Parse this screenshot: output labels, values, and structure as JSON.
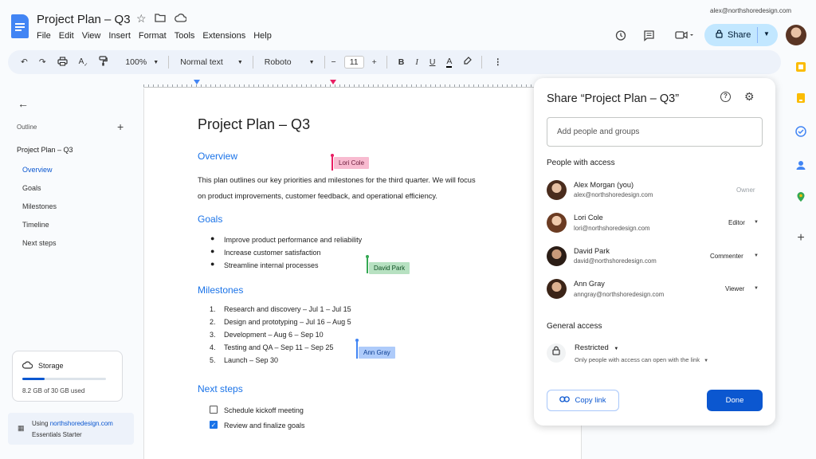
{
  "header": {
    "doc_title": "Project Plan – Q3",
    "account_email": "alex@northshoredesign.com",
    "menu": [
      "File",
      "Edit",
      "View",
      "Insert",
      "Format",
      "Tools",
      "Extensions",
      "Help"
    ],
    "share_label": "Share",
    "icons": [
      "star-icon",
      "folder-icon",
      "cloud-icon",
      "history-icon",
      "comment-icon",
      "video-icon",
      "lock-icon",
      "avatar"
    ]
  },
  "toolbar": {
    "zoom": "100%",
    "style": "Normal text",
    "font": "Roboto",
    "font_size": "11",
    "minus": "−",
    "plus": "+",
    "bold": "B",
    "italic": "I",
    "underline": "U",
    "textcolor": "A"
  },
  "outline": {
    "label": "Outline",
    "doc_title": "Project Plan – Q3",
    "items": [
      "Overview",
      "Goals",
      "Milestones",
      "Timeline",
      "Next steps"
    ],
    "active_item": "Overview",
    "storage_title": "Storage",
    "storage_used": "8.2 GB of 30 GB used",
    "storage_fraction": 0.27,
    "workspace_line1_prefix": "Using ",
    "workspace_domain": "northshoredesign.com",
    "workspace_line2": "Essentials Starter"
  },
  "document": {
    "title": "Project Plan – Q3",
    "overview_heading": "Overview",
    "overview_text": "This plan outlines our key priorities and milestones for the third quarter. We will focus on product improvements, customer feedback, and operational efficiency.",
    "goals_heading": "Goals",
    "goals": [
      "Improve product performance and reliability",
      "Increase customer satisfaction",
      "Streamline internal processes"
    ],
    "milestones_heading": "Milestones",
    "milestones": [
      "Research and discovery – Jul 1 – Jul 15",
      "Design and prototyping – Jul 16 – Aug 5",
      "Development – Aug 6 – Sep 10",
      "Testing and QA – Sep 11 – Sep 25",
      "Launch – Sep 30"
    ],
    "milestone_numbers": [
      "1.",
      "2.",
      "3.",
      "4.",
      "5."
    ],
    "next_heading": "Next steps",
    "tasks": [
      {
        "label": "Schedule kickoff meeting",
        "checked": false
      },
      {
        "label": "Review and finalize goals",
        "checked": true
      }
    ],
    "cursors": [
      {
        "name": "Lori Cole",
        "color": "#f8bbd0",
        "bar": "#e91e63"
      },
      {
        "name": "David Park",
        "color": "#b7e1c1",
        "bar": "#34a853"
      },
      {
        "name": "Ann Gray",
        "color": "#aecbfa",
        "bar": "#4285f4"
      }
    ]
  },
  "share_dialog": {
    "title": "Share “Project Plan – Q3”",
    "add_placeholder": "Add people and groups",
    "people_heading": "People with access",
    "people": [
      {
        "name": "Alex Morgan (you)",
        "email": "alex@northshoredesign.com",
        "role": "Owner"
      },
      {
        "name": "Lori Cole",
        "email": "lori@northshoredesign.com",
        "role": "Editor"
      },
      {
        "name": "David Park",
        "email": "david@northshoredesign.com",
        "role": "Commenter"
      },
      {
        "name": "Ann Gray",
        "email": "anngray@northshoredesign.com",
        "role": "Viewer"
      }
    ],
    "general_heading": "General access",
    "access_level": "Restricted",
    "access_desc": "Only people with access can open with the link",
    "copy_link": "Copy link",
    "done": "Done"
  }
}
